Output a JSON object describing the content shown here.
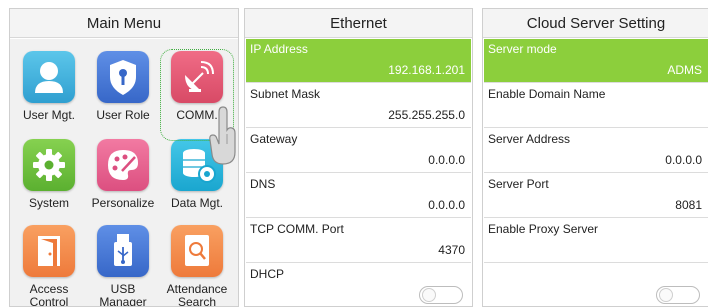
{
  "main_menu": {
    "title": "Main Menu",
    "items": [
      {
        "label": "User Mgt.",
        "icon": "user-icon"
      },
      {
        "label": "User Role",
        "icon": "shield-key-icon"
      },
      {
        "label": "COMM.",
        "icon": "satellite-dish-icon",
        "selected": true
      },
      {
        "label": "System",
        "icon": "gear-icon"
      },
      {
        "label": "Personalize",
        "icon": "palette-icon"
      },
      {
        "label": "Data Mgt.",
        "icon": "database-gear-icon"
      },
      {
        "label": "Access\nControl",
        "icon": "door-icon"
      },
      {
        "label": "USB\nManager",
        "icon": "usb-icon"
      },
      {
        "label": "Attendance\nSearch",
        "icon": "document-search-icon"
      }
    ]
  },
  "ethernet": {
    "title": "Ethernet",
    "rows": [
      {
        "label": "IP Address",
        "value": "192.168.1.201",
        "highlighted": true
      },
      {
        "label": "Subnet Mask",
        "value": "255.255.255.0"
      },
      {
        "label": "Gateway",
        "value": "0.0.0.0"
      },
      {
        "label": "DNS",
        "value": "0.0.0.0"
      },
      {
        "label": "TCP COMM. Port",
        "value": "4370"
      },
      {
        "label": "DHCP",
        "toggle": "off"
      }
    ]
  },
  "cloud": {
    "title": "Cloud Server Setting",
    "rows": [
      {
        "label": "Server mode",
        "value": "ADMS",
        "highlighted": true
      },
      {
        "label": "Enable Domain Name",
        "value": ""
      },
      {
        "label": "Server Address",
        "value": "0.0.0.0"
      },
      {
        "label": "Server Port",
        "value": "8081"
      },
      {
        "label": "Enable Proxy Server",
        "value": ""
      },
      {
        "label": "",
        "toggle": "off"
      }
    ]
  },
  "colors": {
    "highlight": "#8ccf3c",
    "selection_ring": "#3fae3f"
  }
}
